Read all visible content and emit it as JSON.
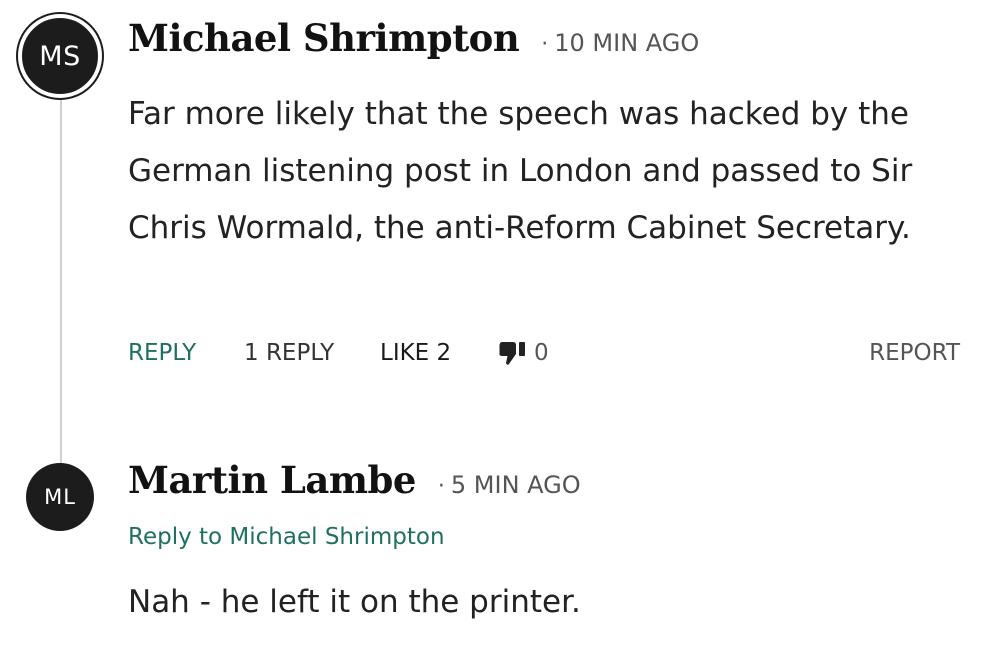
{
  "comments": [
    {
      "initials": "MS",
      "author": "Michael Shrimpton",
      "separator": "·",
      "time": "10 MIN AGO",
      "body": "Far more likely that the speech was hacked by the German listening post in London and passed to Sir Chris Wormald, the anti-Reform Cabinet Secretary.",
      "actions": {
        "reply": "REPLY",
        "replies": "1 REPLY",
        "like": "LIKE 2",
        "dislike_count": "0",
        "report": "REPORT"
      }
    },
    {
      "initials": "ML",
      "author": "Martin Lambe",
      "separator": "·",
      "time": "5 MIN AGO",
      "reply_to_prefix": "Reply to",
      "reply_to_name": "Michael Shrimpton",
      "body": "Nah - he left it on the printer."
    }
  ],
  "colors": {
    "accent": "#1f6f62",
    "avatar_bg": "#1c1c1c",
    "thread_line": "#cfcfcf"
  },
  "icons": {
    "dislike": "thumbs-down-icon"
  }
}
